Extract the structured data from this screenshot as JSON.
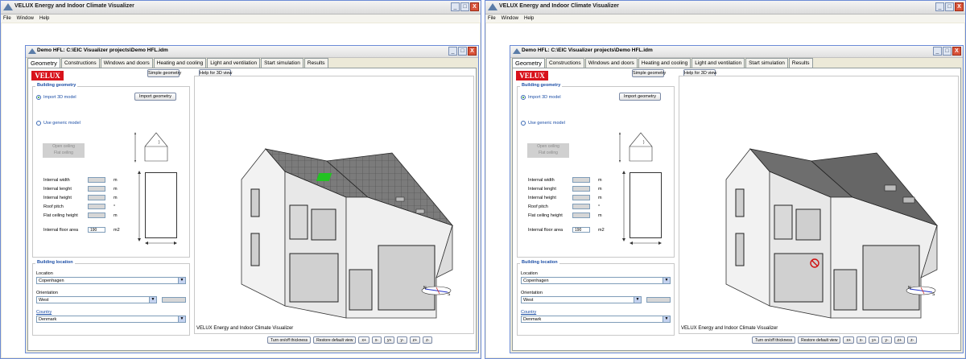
{
  "window": {
    "title": "VELUX Energy and Indoor Climate Visualizer",
    "controls": [
      "_",
      "□",
      "X"
    ]
  },
  "menu": [
    "File",
    "Window",
    "Help"
  ],
  "document": {
    "title": "Demo HFL: C:\\EIC Visualizer projects\\Demo HFL.idm"
  },
  "tabs": [
    "Geometry",
    "Constructions",
    "Windows and doors",
    "Heating and cooling",
    "Light and ventilation",
    "Start simulation",
    "Results"
  ],
  "logo": "VELUX",
  "buttons": {
    "simple_geometry": "Simple geometry",
    "help_3d": "Help for 3D view",
    "import_geometry": "Import geometry",
    "open_ceiling": "Open ceiling",
    "flat_ceiling": "Flat ceiling",
    "toggle_thickness": "Turn on/off thickness",
    "restore_view": "Restore default view",
    "axes": [
      "x+",
      "x-",
      "y+",
      "y-",
      "z+",
      "z-"
    ]
  },
  "geometry_group": {
    "title": "Building geometry",
    "import_label": "Import 3D model",
    "generic_label": "Use generic model",
    "fields": [
      {
        "label": "Internal width",
        "value": "",
        "unit": "m"
      },
      {
        "label": "Internal lenght",
        "value": "",
        "unit": "m"
      },
      {
        "label": "Internal height",
        "value": "",
        "unit": "m"
      },
      {
        "label": "Roof pitch",
        "value": "",
        "unit": "°"
      },
      {
        "label": "Flat ceiling height",
        "value": "",
        "unit": "m"
      }
    ],
    "floor_area": {
      "label": "Internal floor area",
      "value": "190",
      "unit": "m2"
    }
  },
  "location_group": {
    "title": "Building location",
    "location_label": "Location",
    "location_value": "Copenhagen",
    "orientation_label": "Orientation",
    "orientation_value": "West",
    "country_label": "Country",
    "country_value": "Denmark"
  },
  "view_caption": "VELUX Energy and Indoor Climate Visualizer",
  "compass": {
    "north": "N",
    "south": "S"
  },
  "colors": {
    "brand_red": "#d8121b",
    "roof_left": "#7b7b7b",
    "roof_right": "#6a6a6a",
    "selection_green": "#22c322",
    "label_blue": "#1c4ea6"
  }
}
